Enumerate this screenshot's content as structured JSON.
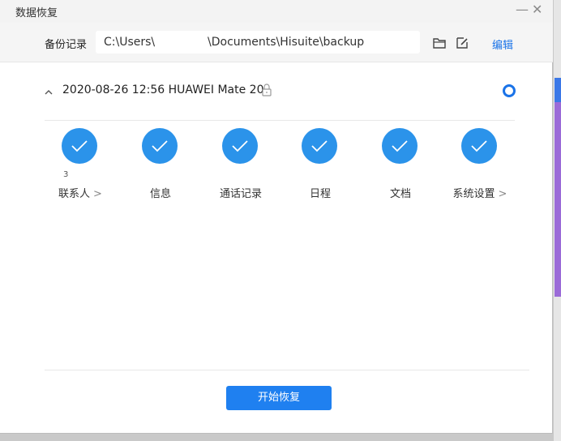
{
  "window": {
    "title": "数据恢复",
    "minimize": "—",
    "close": "✕"
  },
  "path_row": {
    "label": "备份记录",
    "path_user": "C:\\Users\\",
    "path_rest": "\\Documents\\Hisuite\\backup",
    "edit_label": "编辑",
    "icons": [
      "folder-icon",
      "edit-icon"
    ]
  },
  "record": {
    "title": "2020-08-26 12:56 HUAWEI Mate 20",
    "lock_icon": "lock-icon",
    "selected": true
  },
  "categories": [
    {
      "label": "联系人",
      "arrow": ">",
      "count": "3"
    },
    {
      "label": "信息",
      "arrow": ""
    },
    {
      "label": "通话记录",
      "arrow": ""
    },
    {
      "label": "日程",
      "arrow": ""
    },
    {
      "label": "文档",
      "arrow": ""
    },
    {
      "label": "系统设置",
      "arrow": ">"
    }
  ],
  "actions": {
    "start_label": "开始恢复"
  },
  "colors": {
    "accent": "#1f80f0",
    "check": "#2b93ea"
  }
}
